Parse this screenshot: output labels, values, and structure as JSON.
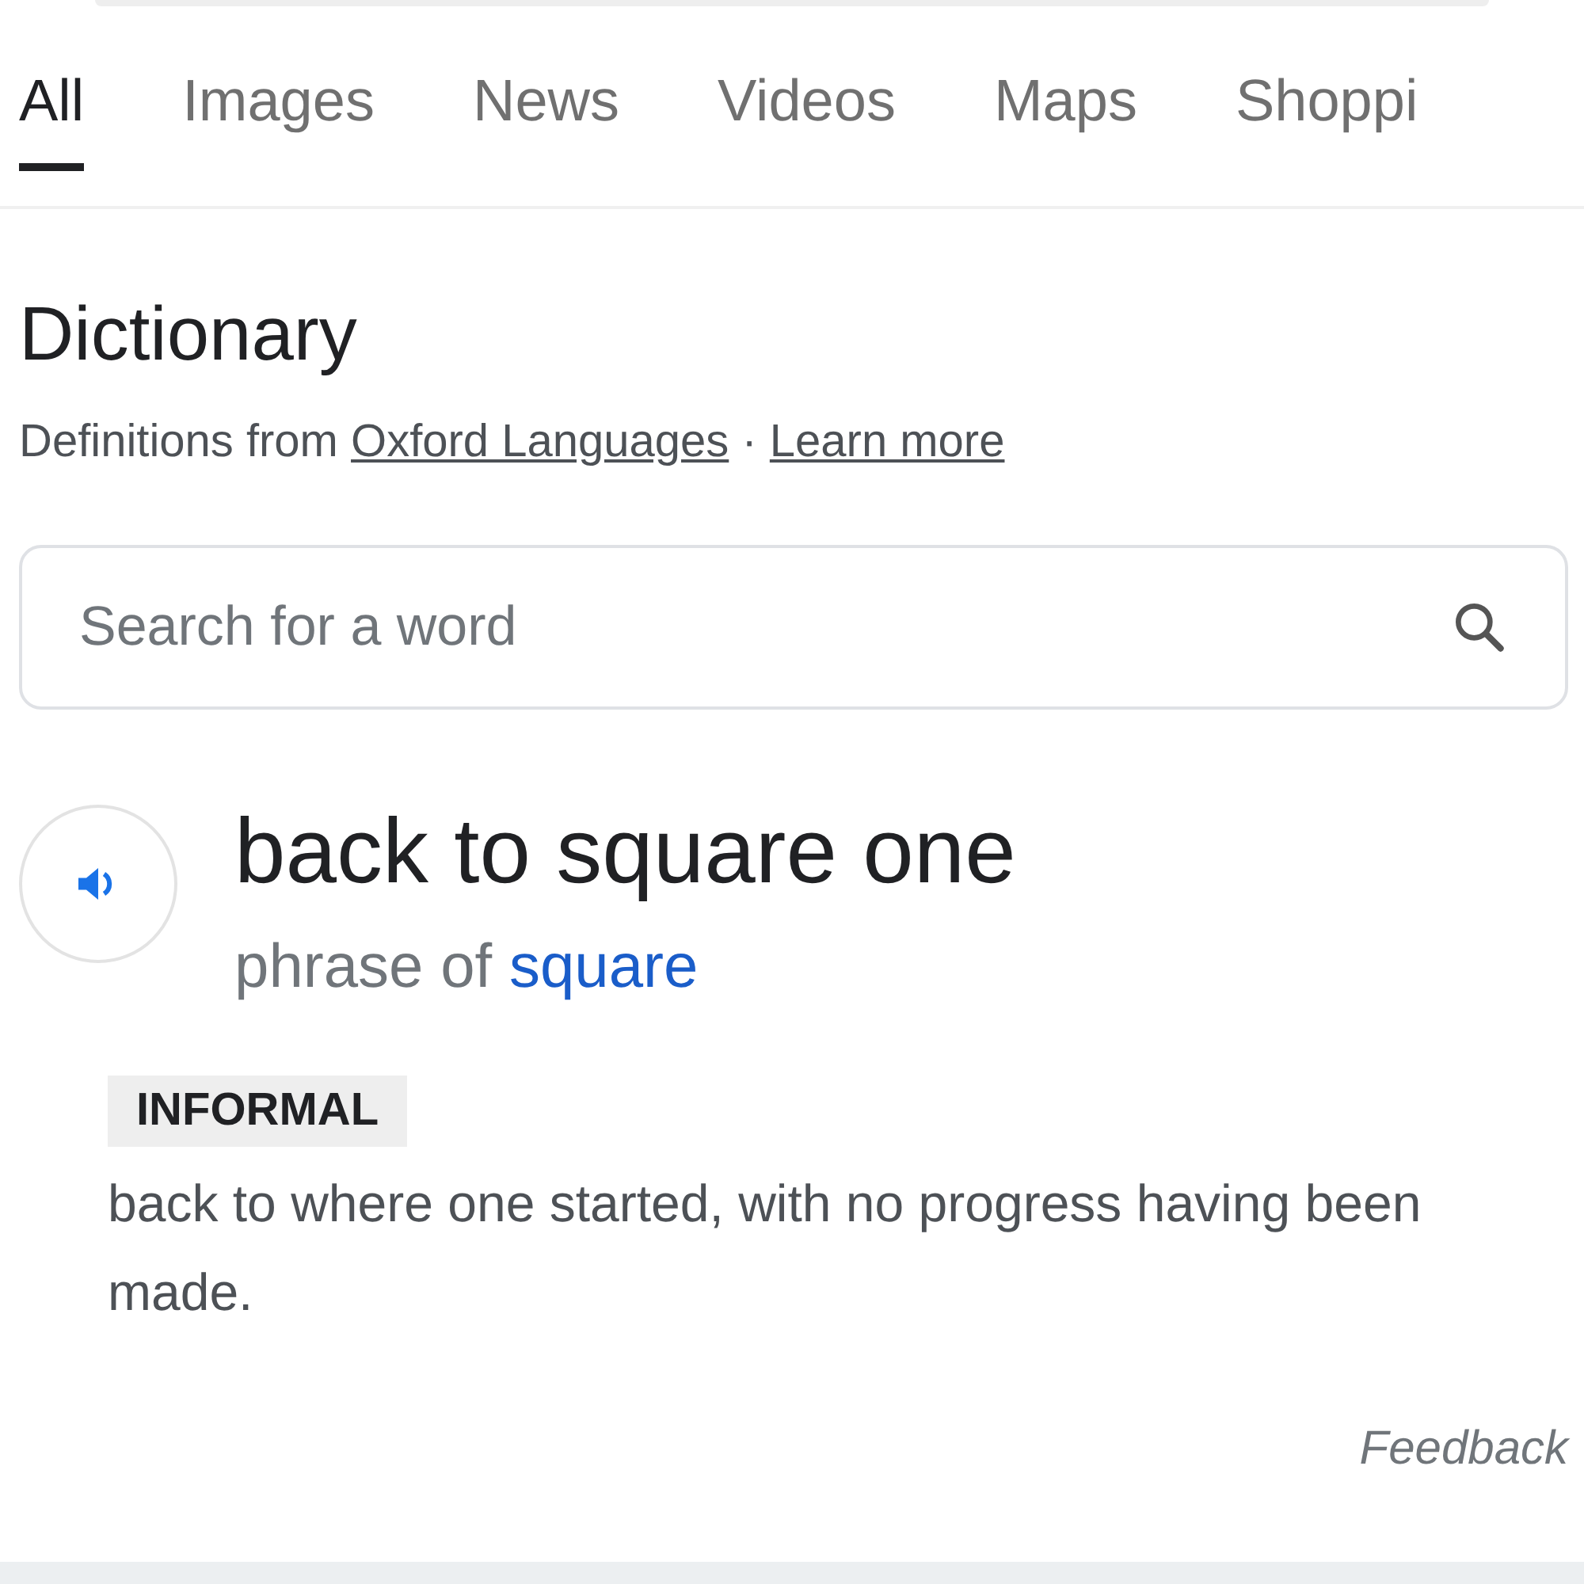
{
  "tabs": [
    {
      "label": "All",
      "selected": true
    },
    {
      "label": "Images",
      "selected": false
    },
    {
      "label": "News",
      "selected": false
    },
    {
      "label": "Videos",
      "selected": false
    },
    {
      "label": "Maps",
      "selected": false
    },
    {
      "label": "Shoppi",
      "selected": false
    }
  ],
  "dictionary": {
    "title": "Dictionary",
    "source_text": "Definitions from",
    "source_link": "Oxford Languages",
    "separator": "·",
    "learn_more": "Learn more",
    "search": {
      "placeholder": "Search for a word"
    },
    "entry": {
      "headword": "back to square one",
      "phrase_prefix": "phrase of",
      "phrase_link": "square",
      "label": "INFORMAL",
      "definition": "back to where one started, with no progress having been made."
    },
    "feedback": "Feedback"
  }
}
